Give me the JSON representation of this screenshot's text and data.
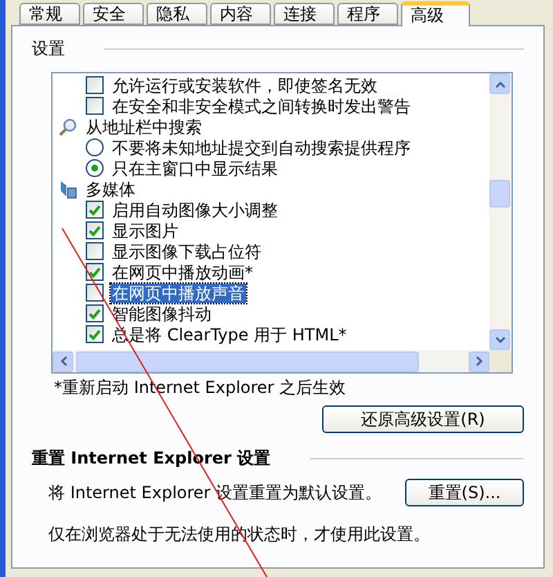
{
  "tabs": [
    {
      "label": "常规",
      "selected": false
    },
    {
      "label": "安全",
      "selected": false
    },
    {
      "label": "隐私",
      "selected": false
    },
    {
      "label": "内容",
      "selected": false
    },
    {
      "label": "连接",
      "selected": false
    },
    {
      "label": "程序",
      "selected": false
    },
    {
      "label": "高级",
      "selected": true
    }
  ],
  "settings": {
    "title": "设置",
    "items": [
      {
        "kind": "checkbox",
        "label": "允许运行或安装软件，即使签名无效",
        "checked": false,
        "highlighted": false
      },
      {
        "kind": "checkbox",
        "label": "在安全和非安全模式之间转换时发出警告",
        "checked": false,
        "highlighted": false
      },
      {
        "kind": "category",
        "label": "从地址栏中搜索"
      },
      {
        "kind": "radio",
        "label": "不要将未知地址提交到自动搜索提供程序",
        "selected": false
      },
      {
        "kind": "radio",
        "label": "只在主窗口中显示结果",
        "selected": true
      },
      {
        "kind": "category",
        "label": "多媒体"
      },
      {
        "kind": "checkbox",
        "label": "启用自动图像大小调整",
        "checked": true,
        "highlighted": false
      },
      {
        "kind": "checkbox",
        "label": "显示图片",
        "checked": true,
        "highlighted": false
      },
      {
        "kind": "checkbox",
        "label": "显示图像下载占位符",
        "checked": false,
        "highlighted": false
      },
      {
        "kind": "checkbox",
        "label": "在网页中播放动画*",
        "checked": true,
        "highlighted": false
      },
      {
        "kind": "checkbox",
        "label": "在网页中播放声音",
        "checked": false,
        "highlighted": true
      },
      {
        "kind": "checkbox",
        "label": "智能图像抖动",
        "checked": true,
        "highlighted": false
      },
      {
        "kind": "checkbox",
        "label": "总是将 ClearType 用于 HTML*",
        "checked": true,
        "highlighted": false
      }
    ],
    "note": "*重新启动 Internet Explorer 之后生效",
    "restore_button": "还原高级设置(R)"
  },
  "reset": {
    "title": "重置 Internet Explorer 设置",
    "description": "将 Internet Explorer 设置重置为默认设置。",
    "button": "重置(S)...",
    "note": "仅在浏览器处于无法使用的状态时，才使用此设置。"
  }
}
